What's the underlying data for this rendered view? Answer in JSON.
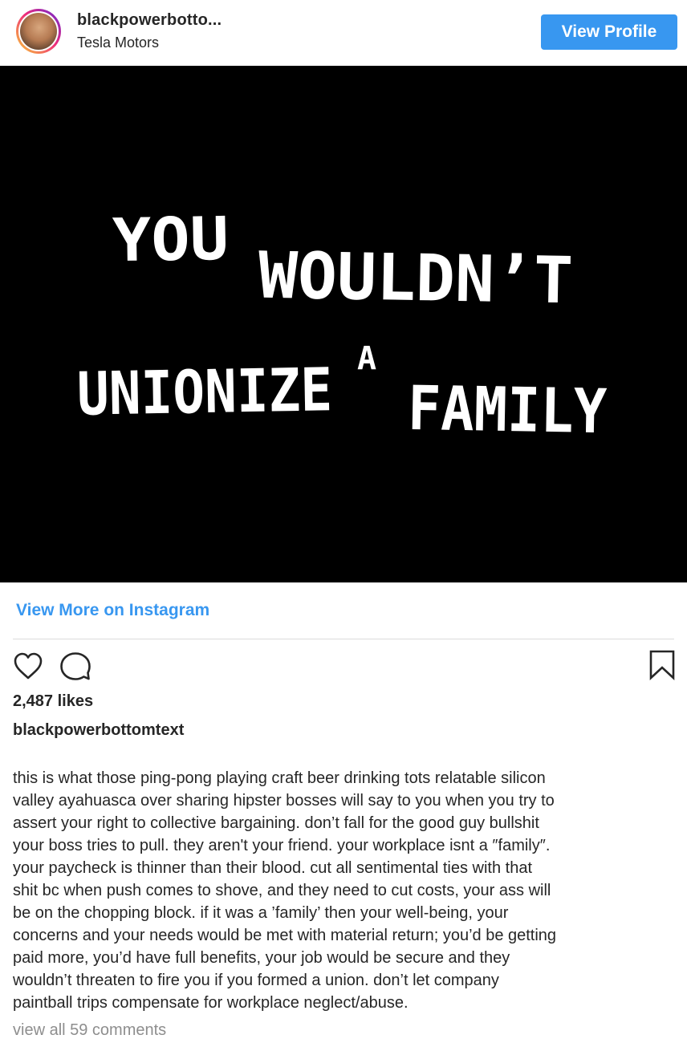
{
  "header": {
    "username": "blackpowerbotto...",
    "location": "Tesla Motors",
    "view_profile_label": "View Profile"
  },
  "post": {
    "image_text": {
      "line1_word1": "YOU",
      "line1_word2": "WOULDN’T",
      "line2_word1": "UNIONIZE",
      "line2_word2": "A",
      "line2_word3": "FAMILY"
    },
    "view_more_label": "View More on Instagram",
    "likes": "2,487 likes",
    "caption_user": "blackpowerbottomtext",
    "caption_lines": [
      "this is what those ping-pong playing craft beer drinking tots relatable silicon",
      "valley ayahuasca over sharing hipster bosses will say to you when you try to",
      "assert your right to collective bargaining. don’t fall for the good guy bullshit",
      "your boss tries to pull. they aren't your friend. your workplace isnt a ″family″.",
      "your paycheck is thinner than their blood. cut all sentimental ties with that",
      "shit bc when push comes to shove, and they need to cut costs, your ass will",
      "be on the chopping block. if it was a ’family’ then your well-being, your",
      "concerns and your needs would be met with material return; you’d be getting",
      "paid more, you’d have full benefits, your job would be secure and they",
      "wouldn’t threaten to fire you if you formed a union. don’t let company",
      "paintball trips compensate for workplace neglect/abuse."
    ],
    "comments_link": "view all 59 comments"
  },
  "icons": {
    "like": "heart-icon",
    "comment": "comment-bubble-icon",
    "save": "bookmark-icon",
    "avatar": "user-avatar"
  },
  "colors": {
    "accent": "#3897f0",
    "text": "#262626",
    "muted": "#8e8e8e",
    "divider": "#dbdbdb",
    "image_background": "#000000"
  }
}
